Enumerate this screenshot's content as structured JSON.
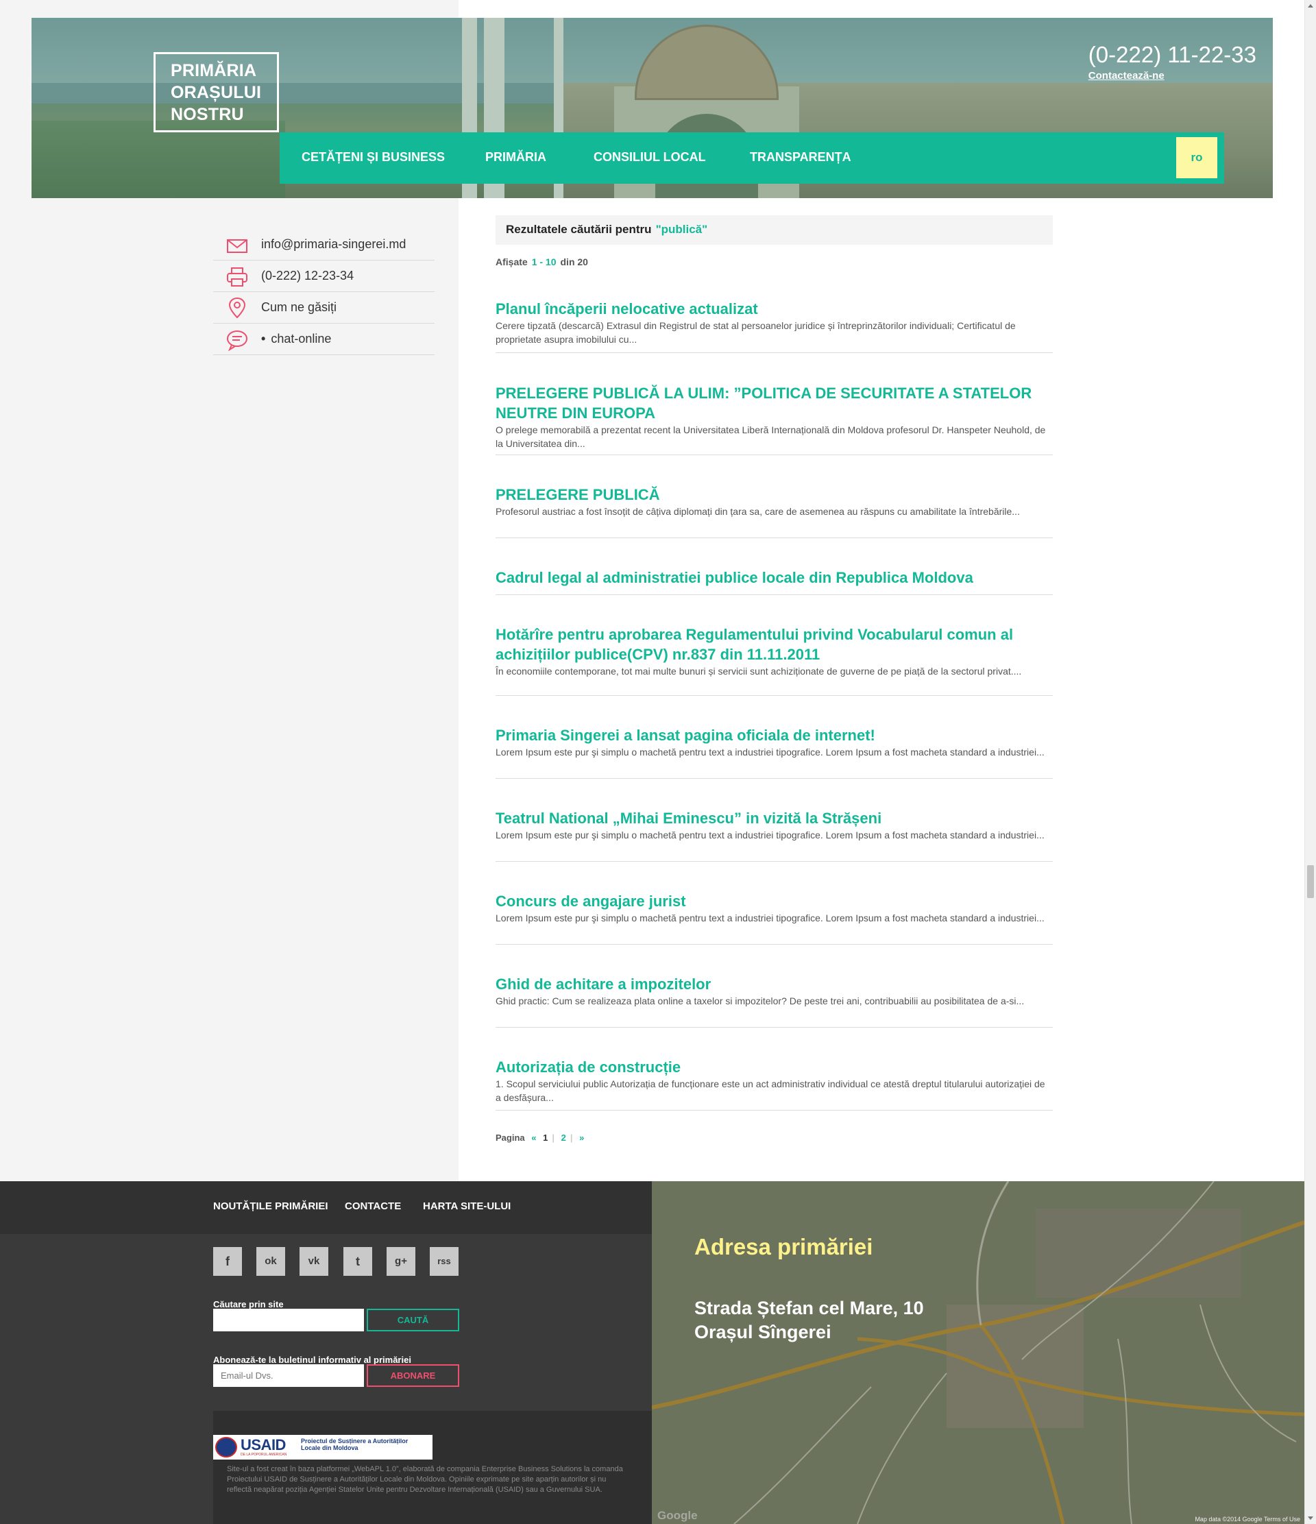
{
  "header": {
    "logo_lines": [
      "PRIMĂRIA",
      "ORAȘULUI",
      "NOSTRU"
    ],
    "phone": "(0-222) 11-22-33",
    "contact_link": "Contactează-ne",
    "nav": [
      "CETĂȚENI ȘI BUSINESS",
      "PRIMĂRIA",
      "CONSILIUL LOCAL",
      "TRANSPARENȚA"
    ],
    "lang": "ro"
  },
  "sidebar": {
    "items": [
      {
        "icon": "envelope-icon",
        "label": "info@primaria-singerei.md"
      },
      {
        "icon": "printer-icon",
        "label": "(0-222) 12-23-34"
      },
      {
        "icon": "map-pin-icon",
        "label": "Cum ne găsiți"
      },
      {
        "icon": "chat-icon",
        "bullet": "•",
        "label": "chat-online"
      }
    ]
  },
  "search": {
    "heading": "Rezultatele căutării pentru",
    "query": "\"publică\"",
    "shown_label": "Afișate",
    "shown_range": "1 - 10",
    "shown_total": "din 20"
  },
  "results": [
    {
      "title": "Planul încăperii nelocative actualizat",
      "desc": "Cerere tipzată (descarcă) Extrasul din Registrul de stat al persoanelor juridice și întreprinzătorilor individuali; Certificatul de proprietate asupra imobilului cu..."
    },
    {
      "title": "PRELEGERE PUBLICĂ LA ULIM: ”POLITICA DE SECURITATE A STATELOR NEUTRE DIN EUROPA",
      "desc": "O prelege memorabilă a prezentat recent la Universitatea Liberă Internațională din Moldova profesorul Dr. Hanspeter Neuhold, de la Universitatea din..."
    },
    {
      "title": "PRELEGERE PUBLICĂ",
      "desc": "Profesorul austriac a fost însoțit de câțiva diplomați din țara sa, care de asemenea au răspuns cu amabilitate la întrebările..."
    },
    {
      "title": "Cadrul legal al administratiei publice locale din Republica Moldova",
      "desc": ""
    },
    {
      "title": "Hotărîre pentru aprobarea Regulamentului privind Vocabularul comun al achizițiilor publice(CPV) nr.837 din 11.11.2011",
      "desc": "În economiile contemporane, tot mai multe bunuri și servicii sunt achiziționate de guverne de pe piață de la sectorul privat...."
    },
    {
      "title": "Primaria Singerei a lansat pagina oficiala de internet!",
      "desc": "Lorem Ipsum este pur şi simplu o machetă pentru text a industriei tipografice. Lorem Ipsum a fost macheta standard a industriei..."
    },
    {
      "title": "Teatrul National „Mihai Eminescu” in vizită la Strășeni",
      "desc": "Lorem Ipsum este pur şi simplu o machetă pentru text a industriei tipografice. Lorem Ipsum a fost macheta standard a industriei..."
    },
    {
      "title": "Concurs de angajare jurist",
      "desc": "Lorem Ipsum este pur şi simplu o machetă pentru text a industriei tipografice. Lorem Ipsum a fost macheta standard a industriei..."
    },
    {
      "title": "Ghid de achitare a impozitelor",
      "desc": "Ghid practic: Cum se realizeaza plata online a taxelor si impozitelor? De peste trei ani, contribuabilii au posibilitatea de a-si..."
    },
    {
      "title": "Autorizația de construcție",
      "desc": "1. Scopul serviciului public Autorizația de funcționare este un act administrativ individual ce atestă dreptul titularului autorizației de a desfășura..."
    }
  ],
  "pager": {
    "label": "Pagina",
    "prev": "«",
    "current": "1",
    "next_page": "2",
    "next": "»"
  },
  "footer": {
    "nav": [
      "NOUTĂȚILE PRIMĂRIEI",
      "CONTACTE",
      "HARTA SITE-ULUI"
    ],
    "social": [
      {
        "icon": "facebook-icon",
        "glyph": "f"
      },
      {
        "icon": "odnoklassniki-icon",
        "glyph": "ok"
      },
      {
        "icon": "vk-icon",
        "glyph": "vk"
      },
      {
        "icon": "twitter-icon",
        "glyph": "t"
      },
      {
        "icon": "google-plus-icon",
        "glyph": "g+"
      },
      {
        "icon": "rss-icon",
        "glyph": "rss"
      }
    ],
    "search_label": "Căutare prin site",
    "search_placeholder": "",
    "search_button": "CAUTĂ",
    "newsletter_label": "Abonează-te la buletinul informativ al primăriei",
    "newsletter_placeholder": "Email-ul Dvs.",
    "newsletter_button": "ABONARE",
    "usaid_name": "USAID",
    "usaid_sub": "DE LA POPORUL AMERICAN",
    "usaid_project": "Proiectul de Susținere a Autorităților Locale din Moldova",
    "note": "Site-ul a fost creat în baza platformei „WebAPL 1.0”, elaborată de compania Enterprise Business Solutions la comanda Proiectului USAID de Susținere a Autorităților Locale din Moldova. Opiniile exprimate pe site aparțin autorilor și nu reflectă neapărat poziția Agenției Statelor Unite pentru Dezvoltare Internațională (USAID) sau a Guvernului SUA."
  },
  "map": {
    "title": "Adresa primăriei",
    "address_line1": "Strada Ștefan cel Mare, 10",
    "address_line2": "Orașul Sîngerei",
    "logo": "Google",
    "credit": "Map data ©2014 Google   Terms of Use"
  },
  "colors": {
    "accent": "#13b897",
    "lang_bg": "#fdf8a4",
    "address_title": "#fdf18c",
    "subscribe": "#ef4f6e",
    "footer_bg": "#3a3a3a"
  }
}
